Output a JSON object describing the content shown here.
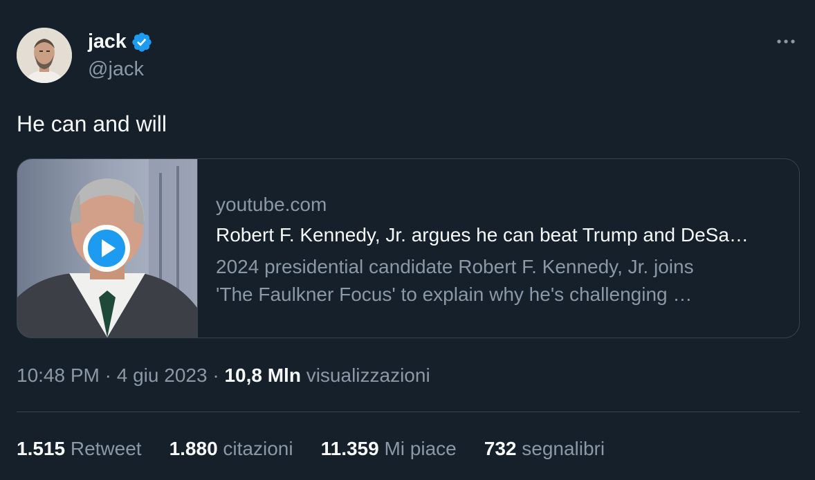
{
  "author": {
    "display_name": "jack",
    "handle": "@jack",
    "verified": true,
    "verified_color": "#1d9bf0"
  },
  "tweet": {
    "text": "He can and will"
  },
  "card": {
    "domain": "youtube.com",
    "title": "Robert F. Kennedy, Jr. argues he can beat Trump and DeSa…",
    "description_line1": "2024 presidential candidate Robert F. Kennedy, Jr. joins",
    "description_line2": "'The Faulkner Focus' to explain why he's challenging …",
    "media_icon": "play-icon"
  },
  "meta": {
    "time": "10:48 PM",
    "sep1": " · ",
    "date": "4 giu 2023",
    "sep2": " · ",
    "views_count": "10,8 Mln",
    "views_label": " visualizzazioni"
  },
  "stats": [
    {
      "count": "1.515",
      "label": " Retweet"
    },
    {
      "count": "1.880",
      "label": " citazioni"
    },
    {
      "count": "11.359",
      "label": " Mi piace"
    },
    {
      "count": "732",
      "label": " segnalibri"
    }
  ],
  "colors": {
    "background": "#15202b",
    "text_primary": "#f7f9f9",
    "text_secondary": "#8b98a5",
    "border": "#38444d",
    "accent": "#1d9bf0"
  }
}
